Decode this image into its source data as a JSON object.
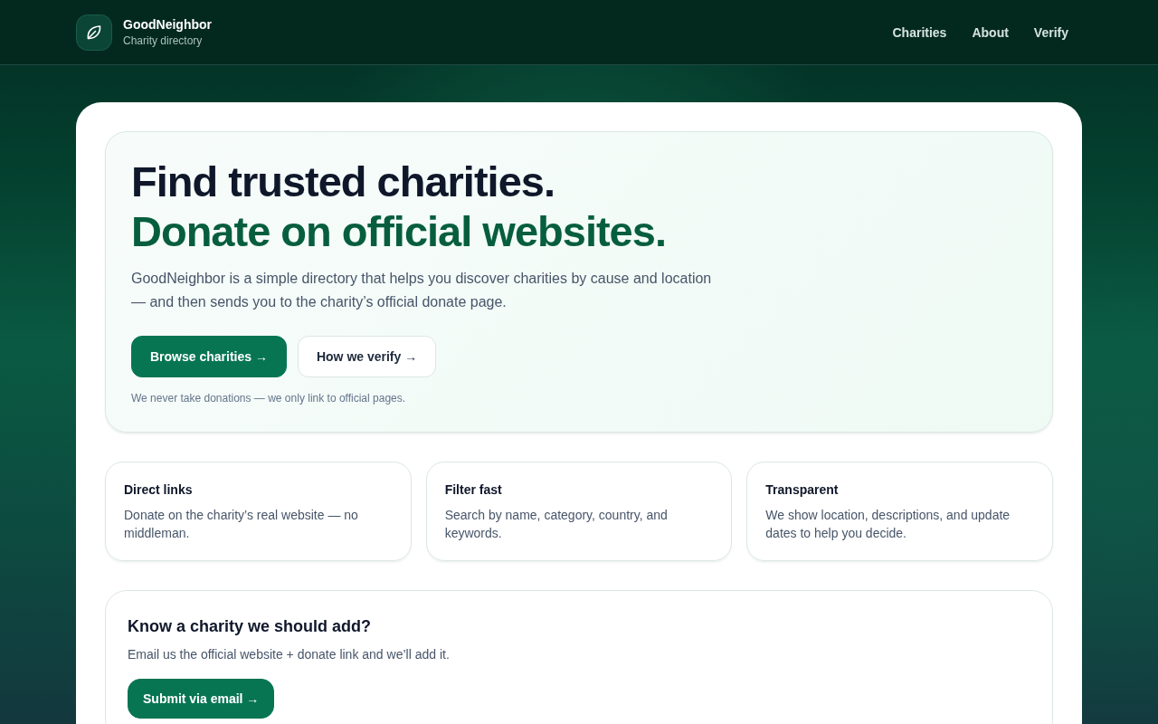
{
  "header": {
    "brand": {
      "name": "GoodNeighbor",
      "tagline": "Charity directory"
    },
    "nav": [
      "Charities",
      "About",
      "Verify"
    ]
  },
  "hero": {
    "title": "Find trusted charities.",
    "subtitle": "Donate on official websites.",
    "description": "GoodNeighbor is a simple directory that helps you discover charities by cause and location — and then sends you to the charity’s official donate page.",
    "buttons": [
      {
        "label": "Browse charities →",
        "kind": "primary"
      },
      {
        "label": "How we verify →",
        "kind": "secondary"
      }
    ],
    "note": "We never take donations — we only link to official pages."
  },
  "features": [
    {
      "title": "Direct links",
      "text": "Donate on the charity’s real website — no middleman."
    },
    {
      "title": "Filter fast",
      "text": "Search by name, category, country, and keywords."
    },
    {
      "title": "Transparent",
      "text": "We show location, descriptions, and update dates to help you decide."
    }
  ],
  "suggest": {
    "title": "Know a charity we should add?",
    "text": "Email us the official website + donate link and we’ll add it.",
    "button": "Submit via email →"
  }
}
